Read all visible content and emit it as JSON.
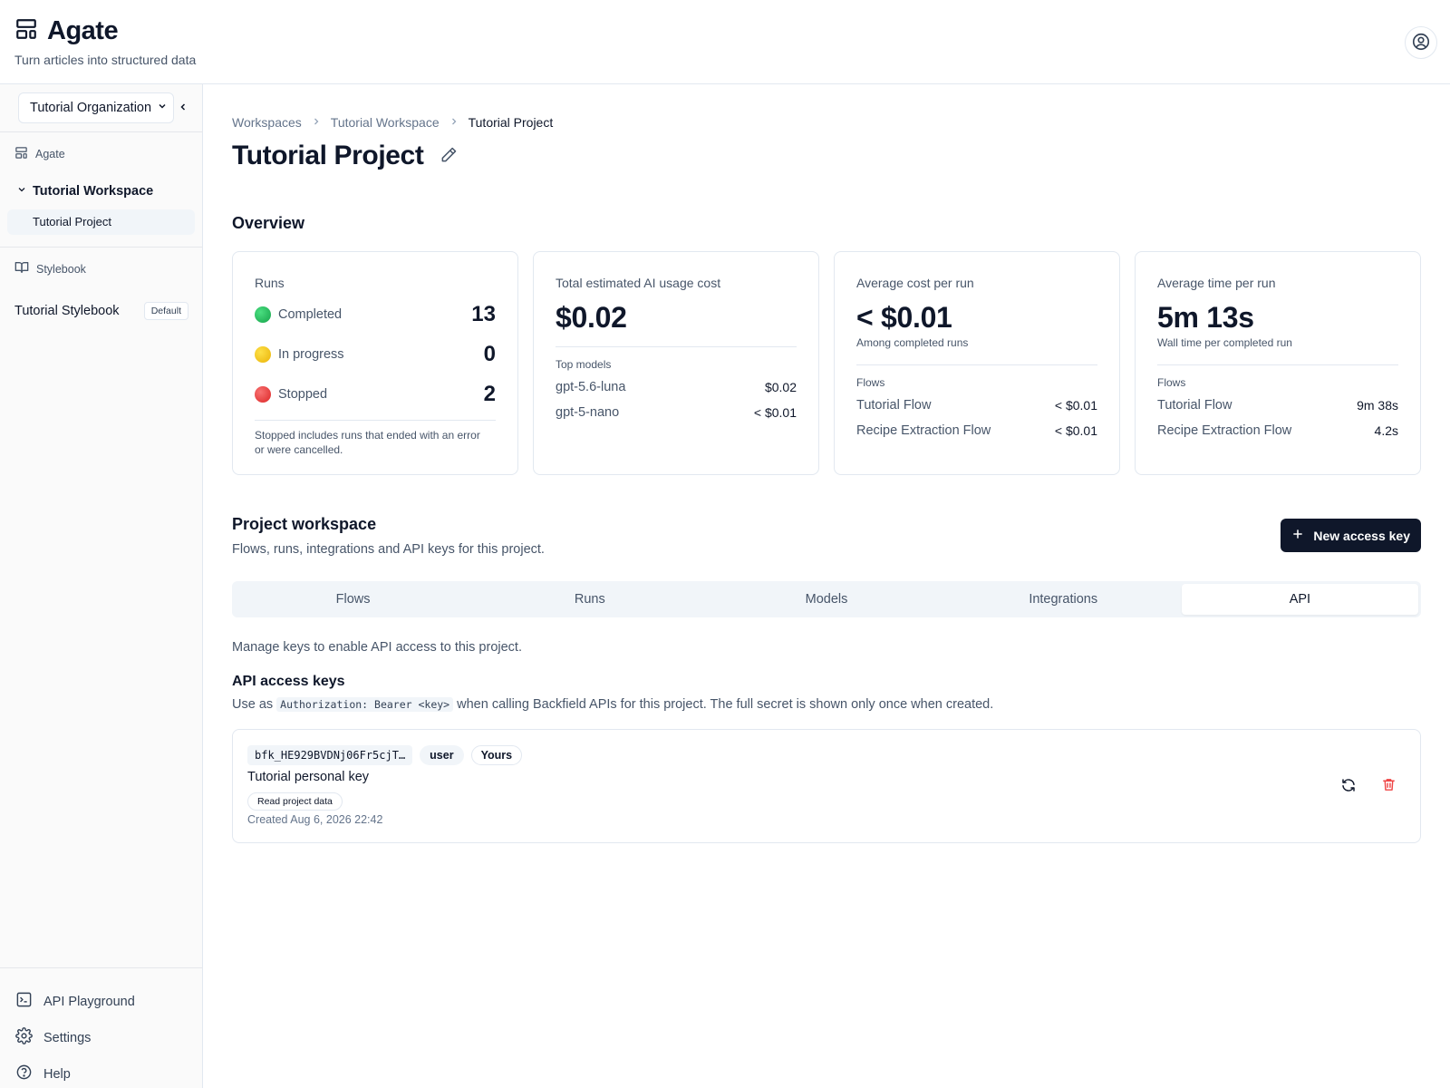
{
  "header": {
    "brand_title": "Agate",
    "tagline": "Turn articles into structured data",
    "brand_icon": "layout-template-icon",
    "avatar_icon": "user-circle-icon"
  },
  "sidebar": {
    "org_select": {
      "value": "Tutorial Organization"
    },
    "agate_label": "Agate",
    "workspace_label": "Tutorial Workspace",
    "project_label": "Tutorial Project",
    "stylebook_section": "Stylebook",
    "stylebook_item": "Tutorial Stylebook",
    "default_badge": "Default",
    "bottom": {
      "api_playground": "API Playground",
      "settings": "Settings",
      "help": "Help"
    }
  },
  "breadcrumb": [
    "Workspaces",
    "Tutorial Workspace",
    "Tutorial Project"
  ],
  "page_title": "Tutorial Project",
  "overview": {
    "title": "Overview",
    "runs": {
      "label": "Runs",
      "items": [
        {
          "label": "Completed",
          "count": "13",
          "color": "#22c55e"
        },
        {
          "label": "In progress",
          "count": "0",
          "color": "#facc15"
        },
        {
          "label": "Stopped",
          "count": "2",
          "color": "#ef4444"
        }
      ],
      "note": "Stopped includes runs that ended with an error or were cancelled."
    },
    "total_cost": {
      "label": "Total estimated AI usage cost",
      "value": "$0.02",
      "models_head": "Top models",
      "models": [
        {
          "name": "gpt-5.6-luna",
          "value": "$0.02"
        },
        {
          "name": "gpt-5-nano",
          "value": "< $0.01"
        }
      ]
    },
    "avg_cost": {
      "label": "Average cost per run",
      "value": "< $0.01",
      "note": "Among completed runs",
      "flows_head": "Flows",
      "flows": [
        {
          "name": "Tutorial Flow",
          "value": "< $0.01"
        },
        {
          "name": "Recipe Extraction Flow",
          "value": "< $0.01"
        }
      ]
    },
    "avg_time": {
      "label": "Average time per run",
      "value": "5m 13s",
      "note": "Wall time per completed run",
      "flows_head": "Flows",
      "flows": [
        {
          "name": "Tutorial Flow",
          "value": "9m 38s"
        },
        {
          "name": "Recipe Extraction Flow",
          "value": "4.2s"
        }
      ]
    }
  },
  "workspace": {
    "title": "Project workspace",
    "subtitle": "Flows, runs, integrations and API keys for this project.",
    "new_key_button": "New access key",
    "tabs": [
      {
        "label": "Flows",
        "active": false
      },
      {
        "label": "Runs",
        "active": false
      },
      {
        "label": "Models",
        "active": false
      },
      {
        "label": "Integrations",
        "active": false
      },
      {
        "label": "API",
        "active": true
      }
    ]
  },
  "api": {
    "intro": "Manage keys to enable API access to this project.",
    "title": "API access keys",
    "desc_before": "Use as",
    "desc_code": "Authorization: Bearer <key>",
    "desc_after": "when calling Backfield APIs for this project. The full secret is shown only once when created.",
    "keys": [
      {
        "prefix": "bfk_HE929BVDNj06Fr5cjT…",
        "type": "user",
        "owner": "Yours",
        "name": "Tutorial personal key",
        "scope": "Read project data",
        "created": "Created Aug 6, 2026 22:42"
      }
    ]
  },
  "colors": {
    "primary": "#0f172a",
    "muted": "#475569",
    "border": "#e2e8f0",
    "danger": "#ef4444"
  }
}
